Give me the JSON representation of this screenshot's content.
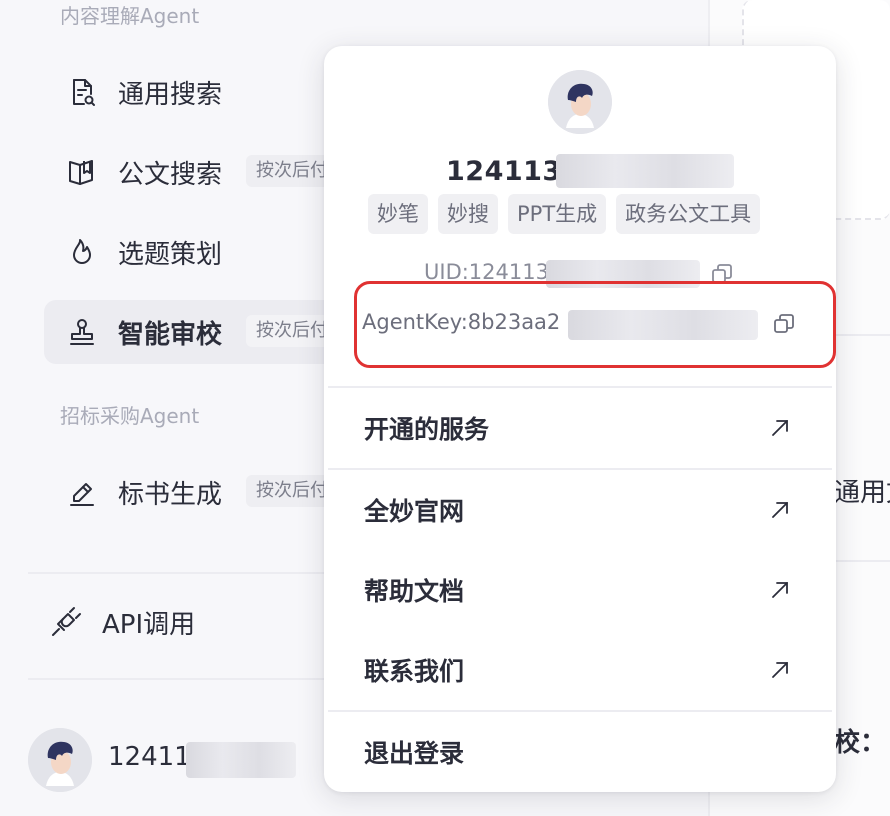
{
  "sidebar": {
    "section_content": "内容理解Agent",
    "section_bidding": "招标采购Agent",
    "items": [
      {
        "label": "通用搜索",
        "icon": "document-search-icon"
      },
      {
        "label": "公文搜索",
        "badge": "按次后付",
        "icon": "book-open-icon"
      },
      {
        "label": "选题策划",
        "icon": "flame-icon"
      },
      {
        "label": "智能审校",
        "badge": "按次后付",
        "icon": "stamp-icon"
      },
      {
        "label": "标书生成",
        "badge": "按次后付",
        "icon": "pen-write-icon"
      }
    ],
    "api": {
      "label": "API调用",
      "icon": "plug-icon"
    },
    "user": {
      "name": "124113"
    }
  },
  "background": {
    "text_1": "通用文",
    "text_2": "校："
  },
  "popover": {
    "name": "1241136",
    "tags": [
      "妙笔",
      "妙搜",
      "PPT生成",
      "政务公文工具"
    ],
    "uid": "UID:124113",
    "agent_key": "AgentKey:8b23aa2",
    "menu": [
      {
        "label": "开通的服务"
      },
      {
        "label": "全妙官网"
      },
      {
        "label": "帮助文档"
      },
      {
        "label": "联系我们"
      }
    ],
    "logout": "退出登录"
  },
  "colors": {
    "highlight": "#e03232",
    "text": "#2b2d3a",
    "muted": "#a9abb8"
  }
}
